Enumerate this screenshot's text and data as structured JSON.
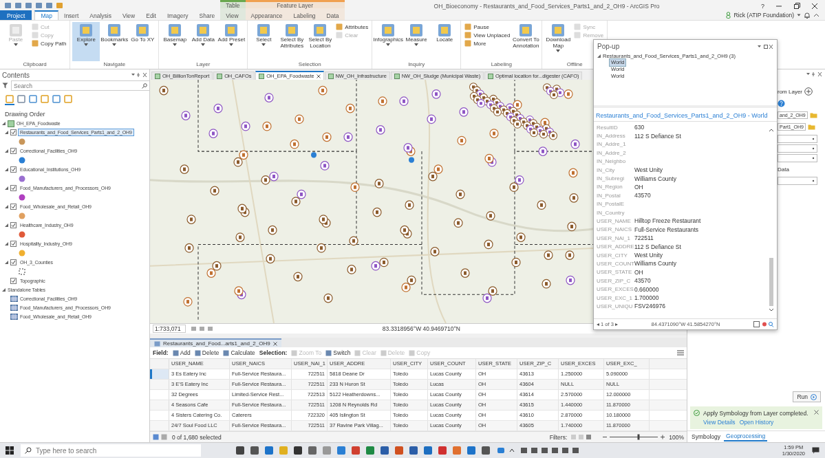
{
  "title_bar": {
    "title": "OH_Bioeconomy - Restaurants_and_Food_Services_Parts1_and_2_OH9 - ArcGIS Pro",
    "help": "?"
  },
  "ribbon_tabs": [
    {
      "label": "Project",
      "kind": "backstage",
      "selected": false
    },
    {
      "label": "Map",
      "kind": "tab",
      "selected": true
    },
    {
      "label": "Insert",
      "kind": "tab",
      "selected": false
    },
    {
      "label": "Analysis",
      "kind": "tab",
      "selected": false
    },
    {
      "label": "View",
      "kind": "tab",
      "selected": false
    },
    {
      "label": "Edit",
      "kind": "tab",
      "selected": false
    },
    {
      "label": "Imagery",
      "kind": "tab",
      "selected": false
    },
    {
      "label": "Share",
      "kind": "tab",
      "selected": false
    }
  ],
  "context_tab_groups": [
    {
      "label": "Table",
      "color": "#6aa84f",
      "tabs": [
        {
          "label": "View",
          "selected": false
        }
      ]
    },
    {
      "label": "Feature Layer",
      "color": "#f0a050",
      "tabs": [
        {
          "label": "Appearance",
          "selected": false
        },
        {
          "label": "Labeling",
          "selected": false
        },
        {
          "label": "Data",
          "selected": false
        }
      ]
    }
  ],
  "user": {
    "name": "Rick (ATIP Foundation)"
  },
  "ribbon_groups": [
    {
      "label": "Clipboard",
      "items": [
        {
          "kind": "large",
          "label": "Paste",
          "disabled": true,
          "selected": false,
          "menu": true
        },
        {
          "kind": "stack",
          "buttons": [
            {
              "label": "Cut",
              "disabled": true
            },
            {
              "label": "Copy",
              "disabled": true
            },
            {
              "label": "Copy Path",
              "disabled": false
            }
          ]
        }
      ]
    },
    {
      "label": "Navigate",
      "items": [
        {
          "kind": "large",
          "label": "Explore",
          "disabled": false,
          "selected": true,
          "menu": true
        },
        {
          "kind": "large",
          "label": "Bookmarks",
          "disabled": false,
          "selected": false,
          "menu": true
        },
        {
          "kind": "large",
          "label": "Go To XY",
          "disabled": false,
          "selected": false,
          "menu": false
        }
      ]
    },
    {
      "label": "Layer",
      "items": [
        {
          "kind": "large",
          "label": "Basemap",
          "disabled": false,
          "selected": false,
          "menu": true
        },
        {
          "kind": "large",
          "label": "Add Data",
          "disabled": false,
          "selected": false,
          "menu": true
        },
        {
          "kind": "large",
          "label": "Add Preset",
          "disabled": false,
          "selected": false,
          "menu": true
        }
      ]
    },
    {
      "label": "Selection",
      "items": [
        {
          "kind": "large",
          "label": "Select",
          "disabled": false,
          "selected": false,
          "menu": true
        },
        {
          "kind": "large",
          "label": "Select By Attributes",
          "disabled": false,
          "selected": false,
          "menu": false
        },
        {
          "kind": "large",
          "label": "Select By Location",
          "disabled": false,
          "selected": false,
          "menu": false
        },
        {
          "kind": "stack",
          "buttons": [
            {
              "label": "Attributes",
              "disabled": false
            },
            {
              "label": "Clear",
              "disabled": true
            }
          ]
        }
      ]
    },
    {
      "label": "Inquiry",
      "items": [
        {
          "kind": "large",
          "label": "Infographics",
          "disabled": false,
          "selected": false,
          "menu": true
        },
        {
          "kind": "large",
          "label": "Measure",
          "disabled": false,
          "selected": false,
          "menu": true
        },
        {
          "kind": "large",
          "label": "Locate",
          "disabled": false,
          "selected": false,
          "menu": false
        }
      ]
    },
    {
      "label": "Labeling",
      "items": [
        {
          "kind": "stack",
          "buttons": [
            {
              "label": "Pause",
              "disabled": false
            },
            {
              "label": "View Unplaced",
              "disabled": false
            },
            {
              "label": "More",
              "disabled": false
            }
          ]
        },
        {
          "kind": "large",
          "label": "Convert To Annotation",
          "disabled": false,
          "selected": false,
          "menu": false
        }
      ]
    },
    {
      "label": "Offline",
      "items": [
        {
          "kind": "large",
          "label": "Download Map",
          "disabled": false,
          "selected": false,
          "menu": true
        },
        {
          "kind": "stack",
          "buttons": [
            {
              "label": "Sync",
              "disabled": true
            },
            {
              "label": "Remove",
              "disabled": true
            }
          ]
        }
      ]
    }
  ],
  "contents": {
    "title": "Contents",
    "search": {
      "placeholder": "Search"
    },
    "heading": "Drawing Order",
    "tree": [
      {
        "label": "OH_EPA_Foodwaste",
        "kind": "map",
        "expanded": true,
        "children": [
          {
            "label": "Restaurants_and_Food_Services_Parts1_and_2_OH9",
            "kind": "layer",
            "expanded": true,
            "checked": true,
            "selected": true,
            "symbol": {
              "kind": "point",
              "color": "#c8965a"
            }
          },
          {
            "label": "Correctional_Facilities_OH9",
            "kind": "layer",
            "expanded": true,
            "checked": true,
            "selected": false,
            "symbol": {
              "kind": "point",
              "color": "#2a7fd4"
            }
          },
          {
            "label": "Educational_Institutions_OH9",
            "kind": "layer",
            "expanded": true,
            "checked": true,
            "selected": false,
            "symbol": {
              "kind": "point",
              "color": "#9a6fd0"
            }
          },
          {
            "label": "Food_Manufacturers_and_Processors_OH9",
            "kind": "layer",
            "expanded": true,
            "checked": true,
            "selected": false,
            "symbol": {
              "kind": "point",
              "color": "#b040c0"
            }
          },
          {
            "label": "Food_Wholesale_and_Retail_OH9",
            "kind": "layer",
            "expanded": true,
            "checked": true,
            "selected": false,
            "symbol": {
              "kind": "point",
              "color": "#e0a060"
            }
          },
          {
            "label": "Healthcare_Industry_OH9",
            "kind": "layer",
            "expanded": true,
            "checked": true,
            "selected": false,
            "symbol": {
              "kind": "point",
              "color": "#e05a3a"
            }
          },
          {
            "label": "Hospitality_Industry_OH9",
            "kind": "layer",
            "expanded": true,
            "checked": true,
            "selected": false,
            "symbol": {
              "kind": "point",
              "color": "#f0b030"
            }
          },
          {
            "label": "OH_3_Counties",
            "kind": "layer",
            "expanded": true,
            "checked": true,
            "selected": false,
            "symbol": {
              "kind": "outline"
            }
          },
          {
            "label": "Topographic",
            "kind": "layer",
            "checked": true,
            "selected": false
          }
        ]
      },
      {
        "label": "Standalone Tables",
        "kind": "group",
        "expanded": true,
        "children": [
          {
            "label": "Correctional_Facilities_OH9",
            "kind": "table"
          },
          {
            "label": "Food_Manufacturers_and_Processors_OH9",
            "kind": "table"
          },
          {
            "label": "Food_Wholesale_and_Retail_OH9",
            "kind": "table"
          }
        ]
      }
    ]
  },
  "map_tabs": [
    {
      "label": "OH_BillionTonReport",
      "selected": false
    },
    {
      "label": "OH_CAFOs",
      "selected": false
    },
    {
      "label": "OH_EPA_Foodwaste",
      "selected": true
    },
    {
      "label": "NW_OH_Infrastructure",
      "selected": false
    },
    {
      "label": "NW_OH_Sludge (Municipal Waste)",
      "selected": false
    },
    {
      "label": "Optimal location for...digester (CAFO)",
      "selected": false
    }
  ],
  "map_status": {
    "scale": "1:733,071",
    "coordinates": "83.3318956°W 40.9469710°N"
  },
  "table": {
    "tab": "Restaurants_and_Food...arts1_and_2_OH9",
    "field_label": "Field:",
    "field_tools": [
      {
        "label": "Add",
        "disabled": false
      },
      {
        "label": "Delete",
        "disabled": false
      },
      {
        "label": "Calculate",
        "disabled": false
      }
    ],
    "selection_label": "Selection:",
    "selection_tools": [
      {
        "label": "Zoom To",
        "disabled": true
      },
      {
        "label": "Switch",
        "disabled": false
      },
      {
        "label": "Clear",
        "disabled": true
      },
      {
        "label": "Delete",
        "disabled": true
      },
      {
        "label": "Copy",
        "disabled": true
      }
    ],
    "columns": [
      {
        "label": "USER_NAME",
        "kind": "text"
      },
      {
        "label": "USER_NAICS",
        "kind": "text"
      },
      {
        "label": "USER_NAI_1",
        "kind": "number"
      },
      {
        "label": "USER_ADDRE",
        "kind": "text"
      },
      {
        "label": "USER_CITY",
        "kind": "text"
      },
      {
        "label": "USER_COUNT",
        "kind": "text"
      },
      {
        "label": "USER_STATE",
        "kind": "text"
      },
      {
        "label": "USER_ZIP_C",
        "kind": "text"
      },
      {
        "label": "USER_EXCES",
        "kind": "text"
      },
      {
        "label": "USER_EXC_",
        "kind": "text"
      }
    ],
    "rows": [
      {
        "selected": true,
        "cells": [
          "3 Es Eatery Inc",
          "Full-Service Restaura...",
          "722511",
          "5818 Deane Dr",
          "Toledo",
          "Lucas County",
          "OH",
          "43613",
          "1.250000",
          "5.090000"
        ]
      },
      {
        "selected": false,
        "cells": [
          "3 E'S Eatery Inc",
          "Full-Service Restaura...",
          "722511",
          "233 N Huron St",
          "Toledo",
          "Lucas",
          "OH",
          "43604",
          "NULL",
          "NULL"
        ]
      },
      {
        "selected": false,
        "cells": [
          "32 Degrees",
          "Limited-Service Rest...",
          "722513",
          "5122 Heatherdowns...",
          "Toledo",
          "Lucas County",
          "OH",
          "43614",
          "2.570000",
          "12.000000"
        ]
      },
      {
        "selected": false,
        "cells": [
          "4 Seasons Cafe",
          "Full-Service Restaura...",
          "722511",
          "1208 N Reynolds Rd",
          "Toledo",
          "Lucas County",
          "OH",
          "43615",
          "1.440000",
          "11.870000"
        ]
      },
      {
        "selected": false,
        "cells": [
          "4 Sisters Catering Co.",
          "Caterers",
          "722320",
          "405 Islington St",
          "Toledo",
          "Lucas County",
          "OH",
          "43610",
          "2.870000",
          "10.180000"
        ]
      },
      {
        "selected": false,
        "cells": [
          "24/7 Soul Food LLC",
          "Full-Service Restaura...",
          "722511",
          "37 Ravine Park Villag...",
          "Toledo",
          "Lucas County",
          "OH",
          "43605",
          "1.740000",
          "11.870000"
        ]
      }
    ],
    "selected_count": "0 of 1,680 selected",
    "filters_label": "Filters:",
    "zoom_slider": {
      "level": 0.6
    },
    "zoom": "100%"
  },
  "popup": {
    "title": "Pop-up",
    "layer": "Restaurants_and_Food_Services_Parts1_and_2_OH9  (3)",
    "features": [
      {
        "label": "World",
        "selected": true
      },
      {
        "label": "World",
        "selected": false
      },
      {
        "label": "World",
        "selected": false
      }
    ],
    "header": "Restaurants_and_Food_Services_Parts1_and_2_OH9 - World",
    "fields": [
      {
        "label": "ResultID",
        "value": "630"
      },
      {
        "label": "IN_Address",
        "value": "112 S Defiance St"
      },
      {
        "label": "IN_Addre_1"
      },
      {
        "label": "IN_Addre_2"
      },
      {
        "label": "IN_Neighbo"
      },
      {
        "label": "IN_City",
        "value": "West Unity"
      },
      {
        "label": "IN_Subregi",
        "value": "Williams County"
      },
      {
        "label": "IN_Region",
        "value": "OH"
      },
      {
        "label": "IN_Postal",
        "value": "43570"
      },
      {
        "label": "IN_PostalE"
      },
      {
        "label": "IN_Country"
      },
      {
        "label": "USER_NAME",
        "value": "Hilltop Freeze Restaurant"
      },
      {
        "label": "USER_NAICS",
        "value": "Full-Service Restaurants"
      },
      {
        "label": "USER_NAI_1",
        "value": "722511"
      },
      {
        "label": "USER_ADDRE",
        "value": "112 S Defiance St"
      },
      {
        "label": "USER_CITY",
        "value": "West Unity"
      },
      {
        "label": "USER_COUNT",
        "value": "Williams County"
      },
      {
        "label": "USER_STATE",
        "value": "OH"
      },
      {
        "label": "USER_ZIP_C",
        "value": "43570"
      },
      {
        "label": "USER_EXCES",
        "value": "0.660000"
      },
      {
        "label": "USER_EXC_1",
        "value": "1.700000"
      },
      {
        "label": "USER_UNIQU",
        "value": "FSV246976"
      }
    ],
    "pager": "◂ 1 of 3 ▸",
    "coordinates": "84.4371090°W 41.5854270°N"
  },
  "geoprocessing": {
    "tool_title": "rom Layer",
    "fields": [
      {
        "value": "and_2_OH9"
      },
      {
        "value": "Part1_OH9"
      }
    ],
    "dropdown_count_label": "Data",
    "run": "Run",
    "notification": {
      "message": "Apply Symbology from Layer completed.",
      "links": [
        "View Details",
        "Open History"
      ]
    },
    "tabs": [
      {
        "label": "Symbology",
        "selected": false
      },
      {
        "label": "Geoprocessing",
        "selected": true
      }
    ]
  },
  "taskbar": {
    "search": {
      "placeholder": "Type here to search"
    },
    "time": "1:59 PM",
    "date": "1/30/2020"
  }
}
